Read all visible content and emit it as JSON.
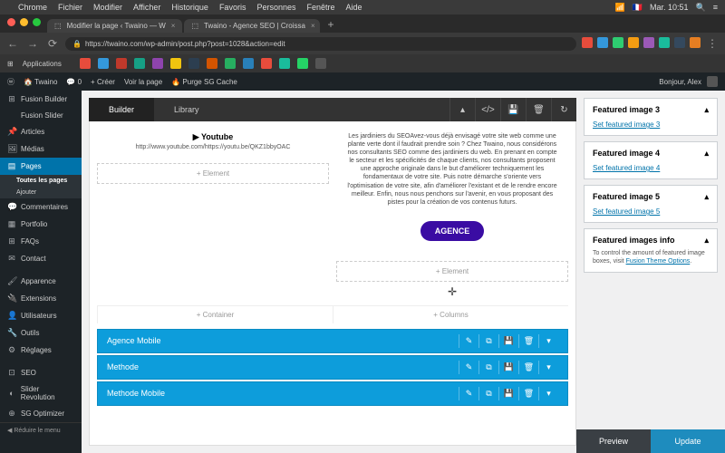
{
  "menubar": {
    "items": [
      "Chrome",
      "Fichier",
      "Modifier",
      "Afficher",
      "Historique",
      "Favoris",
      "Personnes",
      "Fenêtre",
      "Aide"
    ],
    "time": "Mar. 10:51",
    "user": "◯"
  },
  "tabs": {
    "t1": "Modifier la page ‹ Twaino — W",
    "t2": "Twaino - Agence SEO | Croissa"
  },
  "url": "https://twaino.com/wp-admin/post.php?post=1028&action=edit",
  "bookmarks": {
    "apps": "Applications"
  },
  "wpbar": {
    "site": "Twaino",
    "comments": "0",
    "new": "+ Créer",
    "view": "Voir la page",
    "purge": "Purge SG Cache",
    "greeting": "Bonjour, Alex"
  },
  "sidebar": {
    "items": [
      {
        "icon": "⊞",
        "label": "Fusion Builder"
      },
      {
        "icon": "",
        "label": "Fusion Slider"
      },
      {
        "icon": "📌",
        "label": "Articles"
      },
      {
        "icon": "🖼",
        "label": "Médias"
      },
      {
        "icon": "▤",
        "label": "Pages",
        "active": true
      },
      {
        "icon": "💬",
        "label": "Commentaires"
      },
      {
        "icon": "▦",
        "label": "Portfolio"
      },
      {
        "icon": "⊞",
        "label": "FAQs"
      },
      {
        "icon": "✉",
        "label": "Contact"
      },
      {
        "icon": "🖌",
        "label": "Apparence"
      },
      {
        "icon": "🔌",
        "label": "Extensions"
      },
      {
        "icon": "👤",
        "label": "Utilisateurs"
      },
      {
        "icon": "🔧",
        "label": "Outils"
      },
      {
        "icon": "⚙",
        "label": "Réglages"
      },
      {
        "icon": "⊡",
        "label": "SEO"
      },
      {
        "icon": "◐",
        "label": "Slider Revolution"
      },
      {
        "icon": "⊕",
        "label": "SG Optimizer"
      }
    ],
    "subs": {
      "all": "Toutes les pages",
      "add": "Ajouter"
    },
    "collapse": "Réduire le menu"
  },
  "builder": {
    "tabs": {
      "builder": "Builder",
      "library": "Library"
    },
    "youtube": {
      "title": "Youtube",
      "icon": "▶",
      "url": "http://www.youtube.com/https://youtu.be/QKZ1bbyOAC"
    },
    "addElement": "+ Element",
    "addContainer": "+ Container",
    "addColumns": "+ Columns",
    "paragraph": "Les jardiniers du SEOAvez-vous déjà envisagé votre site web comme une plante verte dont il faudrait prendre soin ? Chez Twaino, nous considérons nos consultants SEO comme des jardiniers du web. En prenant en compte le secteur et les spécificités de chaque clients, nos consultants proposent une approche originale dans le but d'améliorer techniquement les fondamentaux de votre site. Puis notre démarche s'oriente vers l'optimisation de votre site, afin d'améliorer l'existant et de le rendre encore meilleur. Enfin, nous nous penchons sur l'avenir, en vous proposant des pistes pour la création de vos contenus futurs.",
    "agenceBtn": "AGENCE",
    "sections": [
      "Agence Mobile",
      "Methode",
      "Methode Mobile"
    ]
  },
  "meta": {
    "boxes": [
      {
        "title": "Featured image 3",
        "link": "Set featured image 3"
      },
      {
        "title": "Featured image 4",
        "link": "Set featured image 4"
      },
      {
        "title": "Featured image 5",
        "link": "Set featured image 5"
      }
    ],
    "info": {
      "title": "Featured images info",
      "text": "To control the amount of featured image boxes, visit ",
      "link": "Fusion Theme Options"
    }
  },
  "publish": {
    "preview": "Preview",
    "update": "Update"
  }
}
